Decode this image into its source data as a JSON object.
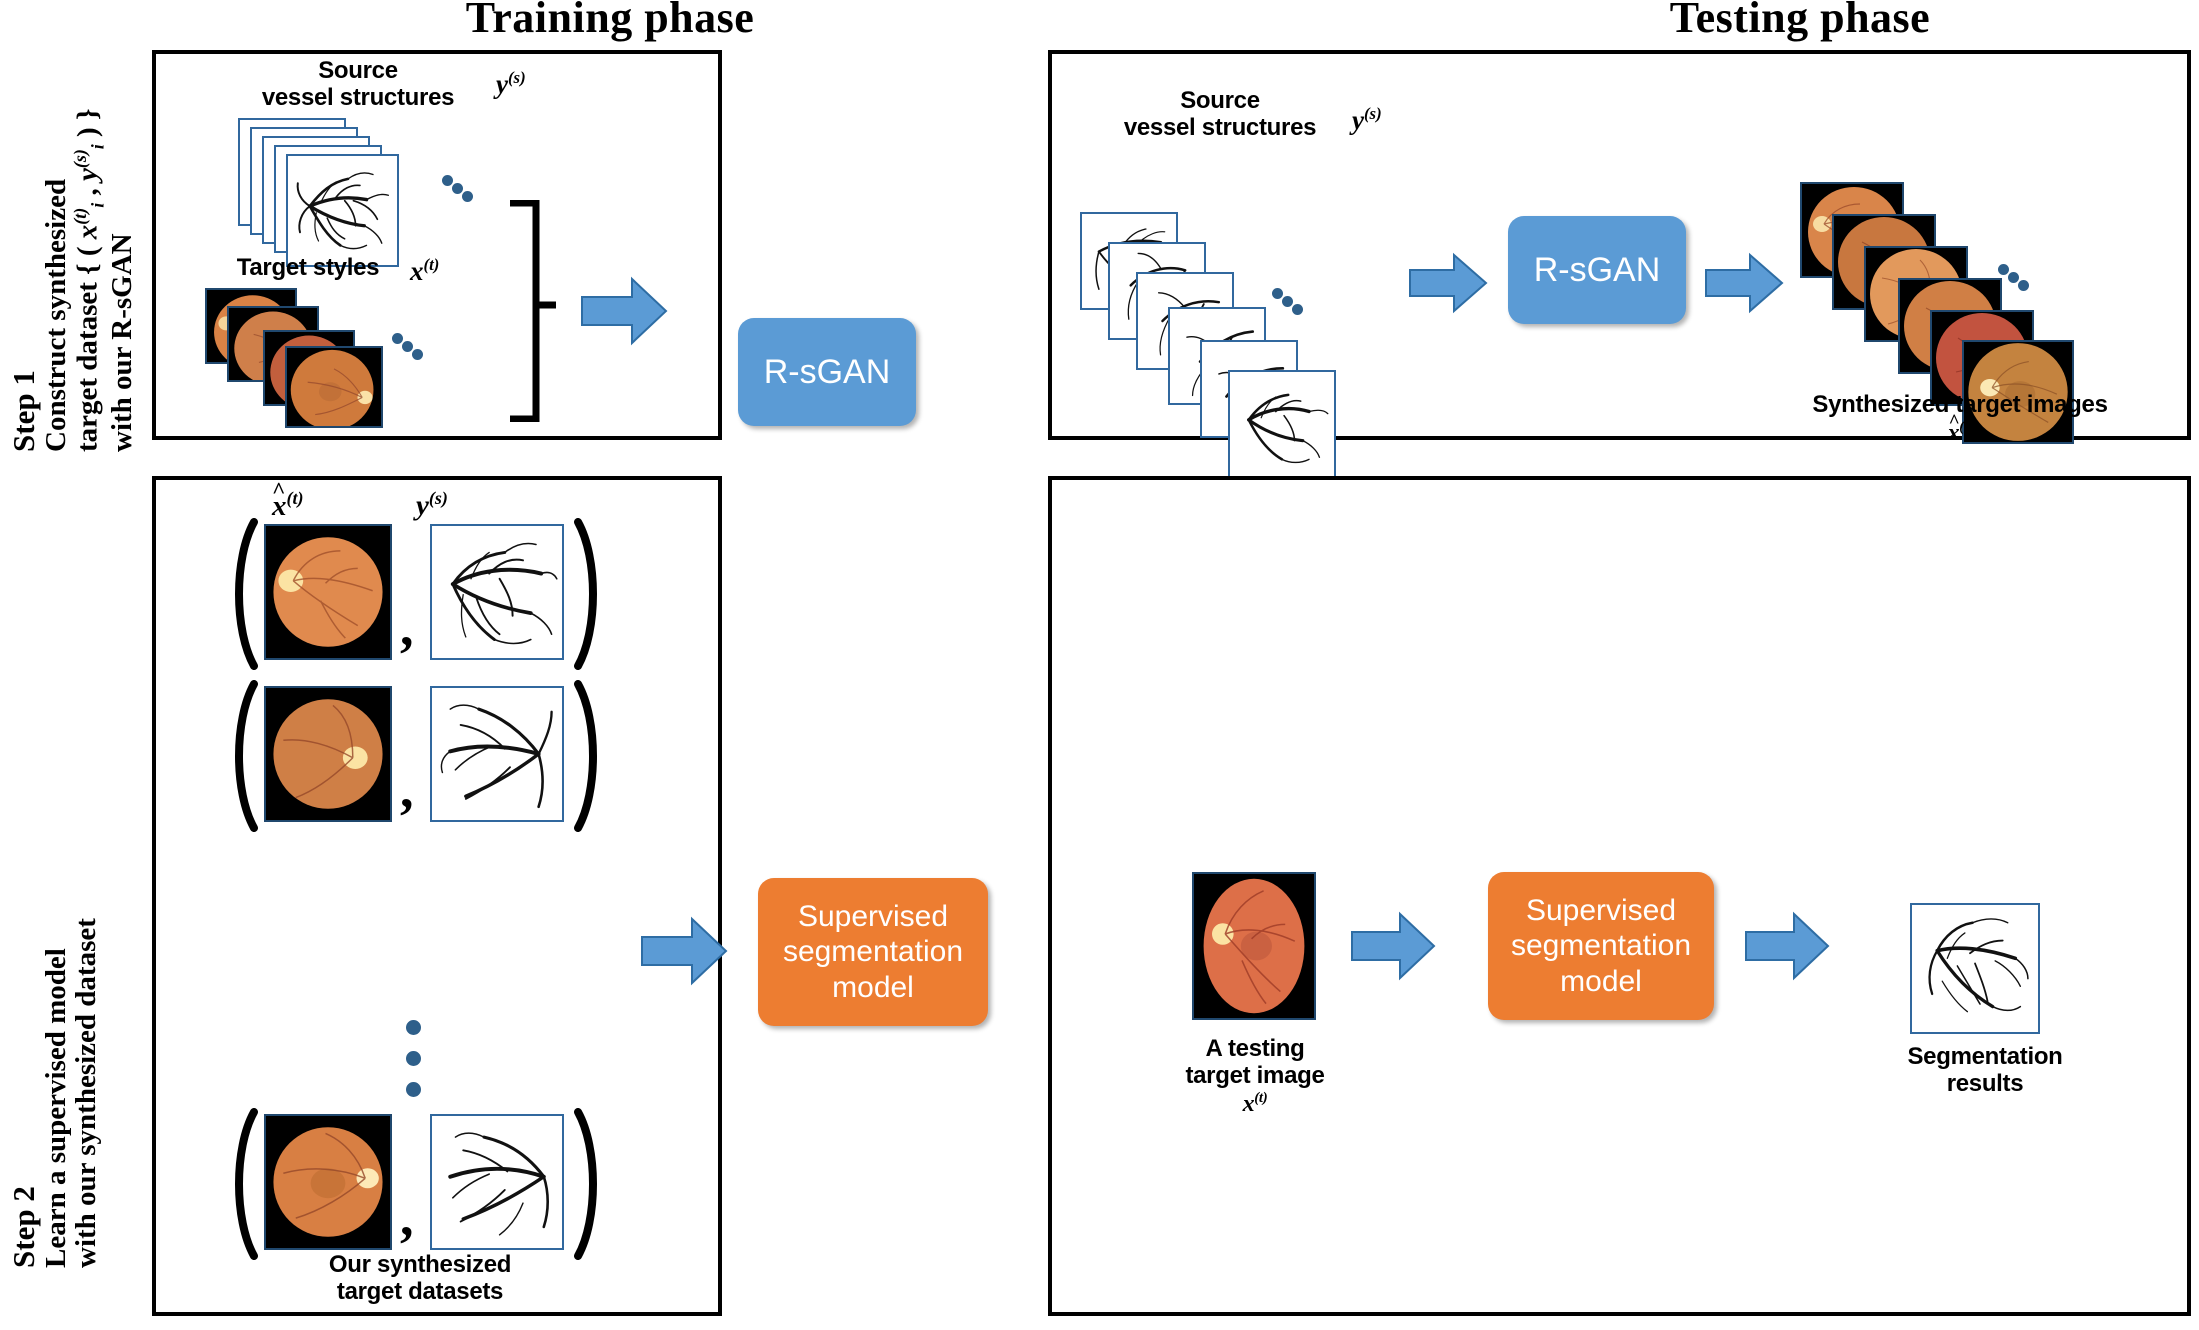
{
  "headings": {
    "training": "Training phase",
    "testing": "Testing phase"
  },
  "steps": {
    "step1": {
      "title": "Step 1",
      "line1": "Construct synthesized",
      "line2_pre": "target dataset  {  ( ",
      "line2_x": "x",
      "line2_x_sup": "(t)",
      "line2_x_sub": "i",
      "line2_mid": " ,  ",
      "line2_y": "y",
      "line2_y_sup": "(s)",
      "line2_y_sub": "i",
      "line2_post": " ) }",
      "line3": "with our R-sGAN"
    },
    "step2": {
      "title": "Step 2",
      "line1": "Learn a supervised model",
      "line2": "with our synthesized dataset"
    }
  },
  "training_step1": {
    "source_caption_l1": "Source",
    "source_caption_l2": "vessel structures",
    "source_symbol": "y",
    "source_symbol_sup": "(s)",
    "target_caption": "Target styles",
    "target_symbol": "x",
    "target_symbol_sup": "(t)",
    "model_label": "R-sGAN"
  },
  "testing_step1": {
    "source_caption_l1": "Source",
    "source_caption_l2": "vessel structures",
    "source_symbol": "y",
    "source_symbol_sup": "(s)",
    "model_label": "R-sGAN",
    "output_caption": "Synthesized target images",
    "output_symbol": "x",
    "output_symbol_sup": "(t)"
  },
  "training_step2": {
    "col1_symbol": "x",
    "col1_symbol_sup": "(t)",
    "col2_symbol": "y",
    "col2_symbol_sup": "(s)",
    "pair_separator": ",",
    "dataset_caption_l1": "Our synthesized",
    "dataset_caption_l2": "target datasets",
    "model_label_l1": "Supervised",
    "model_label_l2": "segmentation",
    "model_label_l3": "model"
  },
  "testing_step2": {
    "input_caption_l1": "A testing",
    "input_caption_l2": "target image",
    "input_symbol": "x",
    "input_symbol_sup": "(t)",
    "model_label_l1": "Supervised",
    "model_label_l2": "segmentation",
    "model_label_l3": "model",
    "output_caption_l1": "Segmentation",
    "output_caption_l2": "results"
  },
  "colors": {
    "model_blue": "#5B9BD5",
    "model_orange": "#ED7D31",
    "arrow_blue": "#5B9BD5",
    "arrow_blue_edge": "#2E6DA4",
    "card_border_blue": "#31689E",
    "panel_border": "#000000",
    "dot_blue": "#2E5F8A"
  }
}
